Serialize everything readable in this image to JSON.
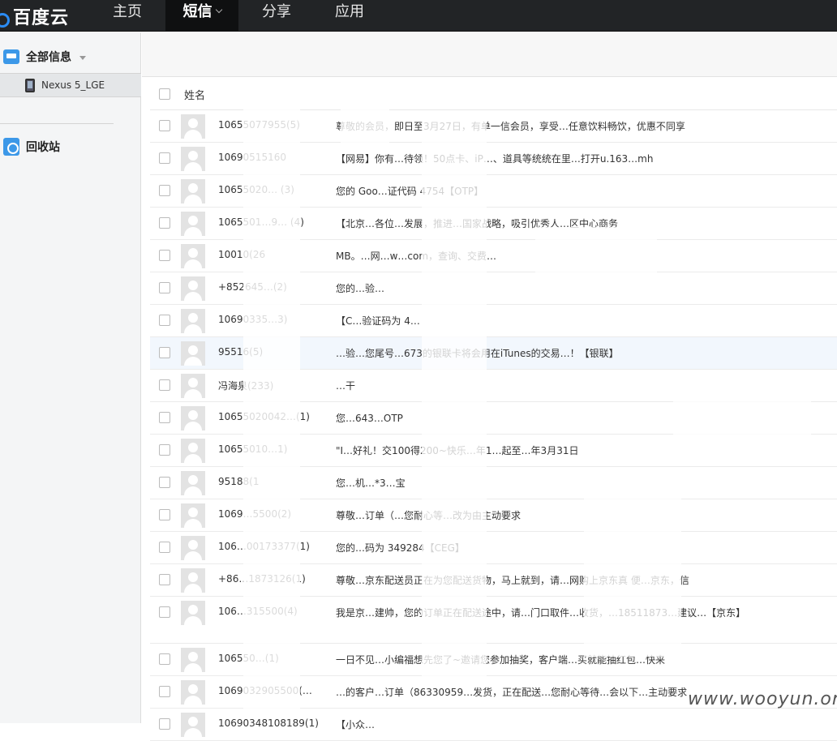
{
  "app": {
    "logo": "百度云",
    "nav": {
      "home": "主页",
      "sms": "短信",
      "share": "分享",
      "apps": "应用"
    }
  },
  "sidebar": {
    "all_messages": "全部信息",
    "device": "Nexus 5_LGE",
    "trash": "回收站"
  },
  "list": {
    "header_name": "姓名",
    "rows": [
      {
        "sender": "10655077955(5)",
        "preview": "尊敬的会员，即日至3月27日，有单一信会员，享受…任意饮料畅饮，优惠不同享"
      },
      {
        "sender": "10690515160",
        "preview": "【网易】你有…待领！50点卡、iP…、道具等统统在里…打开u.163…mh"
      },
      {
        "sender": "10655020… (3)",
        "preview": "您的 Goo…证代码 4754【OTP】"
      },
      {
        "sender": "1065501…9… (4)",
        "preview": "【北京…各位…发展，推进…国家战略，吸引优秀人…区中心商务"
      },
      {
        "sender": "10010(26",
        "preview": "MB。…网…w…com，查询、交费…"
      },
      {
        "sender": "+852645…(2)",
        "preview": "您的…验…"
      },
      {
        "sender": "10690335…3)",
        "preview": "【C…验证码为 4…"
      },
      {
        "sender": "95516(5)",
        "preview": "…验…您尾号…673的银联卡将会用在iTunes的交易…！【银联】"
      },
      {
        "sender": "冯海泉(233)",
        "preview": "…干"
      },
      {
        "sender": "10655020042…(1)",
        "preview": "您…643…OTP"
      },
      {
        "sender": "10655010…1)",
        "preview": "\"I…好礼！交100得200~快乐…年1…起至…年3月31日"
      },
      {
        "sender": "95188(1",
        "preview": "您…机…*3…宝"
      },
      {
        "sender": "1069…5500(2)",
        "preview": "尊敬…订单（…您耐心等…改为由主动要求"
      },
      {
        "sender": "106…00173377(1)",
        "preview": "您的…码为 349284【CEG】"
      },
      {
        "sender": "+86…1873126(1)",
        "preview": "尊敬…京东配送员正在为您配送货物，马上就到，请…网购上京东真 便…京东，信"
      },
      {
        "sender": "106…315500(4)",
        "preview": "我是京…建帅，您的订单正在配送途中，请…门口取件…收货，…18511873…建议…【京东】"
      },
      {
        "sender": "106550…(1)",
        "preview": "一日不见…小编福想先您了~邀请您参加抽奖，客户端…买就能抽红包…快来"
      },
      {
        "sender": "1069032905500(…",
        "preview": "…的客户…订单（86330959…发货，正在配送…您耐心等待…会以下…主动要求"
      },
      {
        "sender": "10690348108189(1)",
        "preview": "【小众…"
      }
    ]
  },
  "watermark": "www.wooyun.org"
}
